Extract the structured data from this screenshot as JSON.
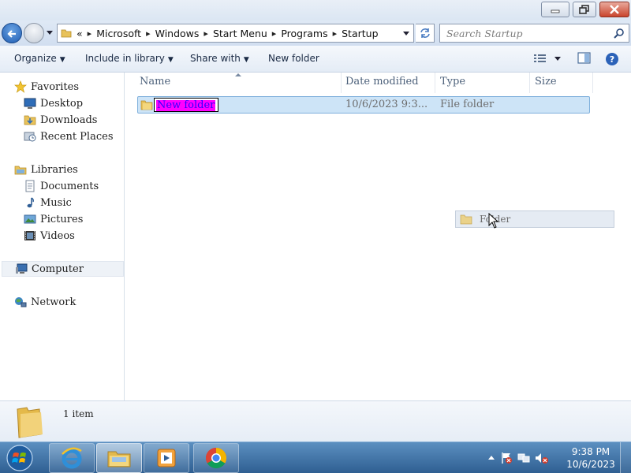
{
  "window": {
    "caption_buttons": [
      "minimize-icon",
      "restore-icon",
      "close-icon"
    ]
  },
  "address": {
    "overflow": "«",
    "crumbs": [
      "Microsoft",
      "Windows",
      "Start Menu",
      "Programs",
      "Startup"
    ],
    "search_placeholder": "Search Startup"
  },
  "toolbar": {
    "organize": "Organize",
    "include_in_library": "Include in library",
    "share_with": "Share with",
    "new_folder": "New folder"
  },
  "nav": {
    "favorites": "Favorites",
    "desktop": "Desktop",
    "downloads": "Downloads",
    "recent_places": "Recent Places",
    "libraries": "Libraries",
    "documents": "Documents",
    "music": "Music",
    "pictures": "Pictures",
    "videos": "Videos",
    "computer": "Computer",
    "network": "Network"
  },
  "columns": {
    "name": "Name",
    "date_modified": "Date modified",
    "type": "Type",
    "size": "Size"
  },
  "files": [
    {
      "name": "New folder",
      "date_modified": "10/6/2023 9:3...",
      "type": "File folder",
      "size": ""
    }
  ],
  "drag_ghost": {
    "label": "Folder"
  },
  "details": {
    "item_count": "1 item"
  },
  "taskbar": {
    "time": "9:38 PM",
    "date": "10/6/2023",
    "apps": [
      "windows-start-icon",
      "internet-explorer-icon",
      "file-explorer-icon",
      "media-player-icon",
      "chrome-icon"
    ]
  },
  "colors": {
    "selection_bg": "#cde4f7",
    "selection_border": "#7fb0dc",
    "rename_highlight": "#ff00ff",
    "taskbar": "#3e6fa3",
    "close_button": "#c9442c"
  }
}
